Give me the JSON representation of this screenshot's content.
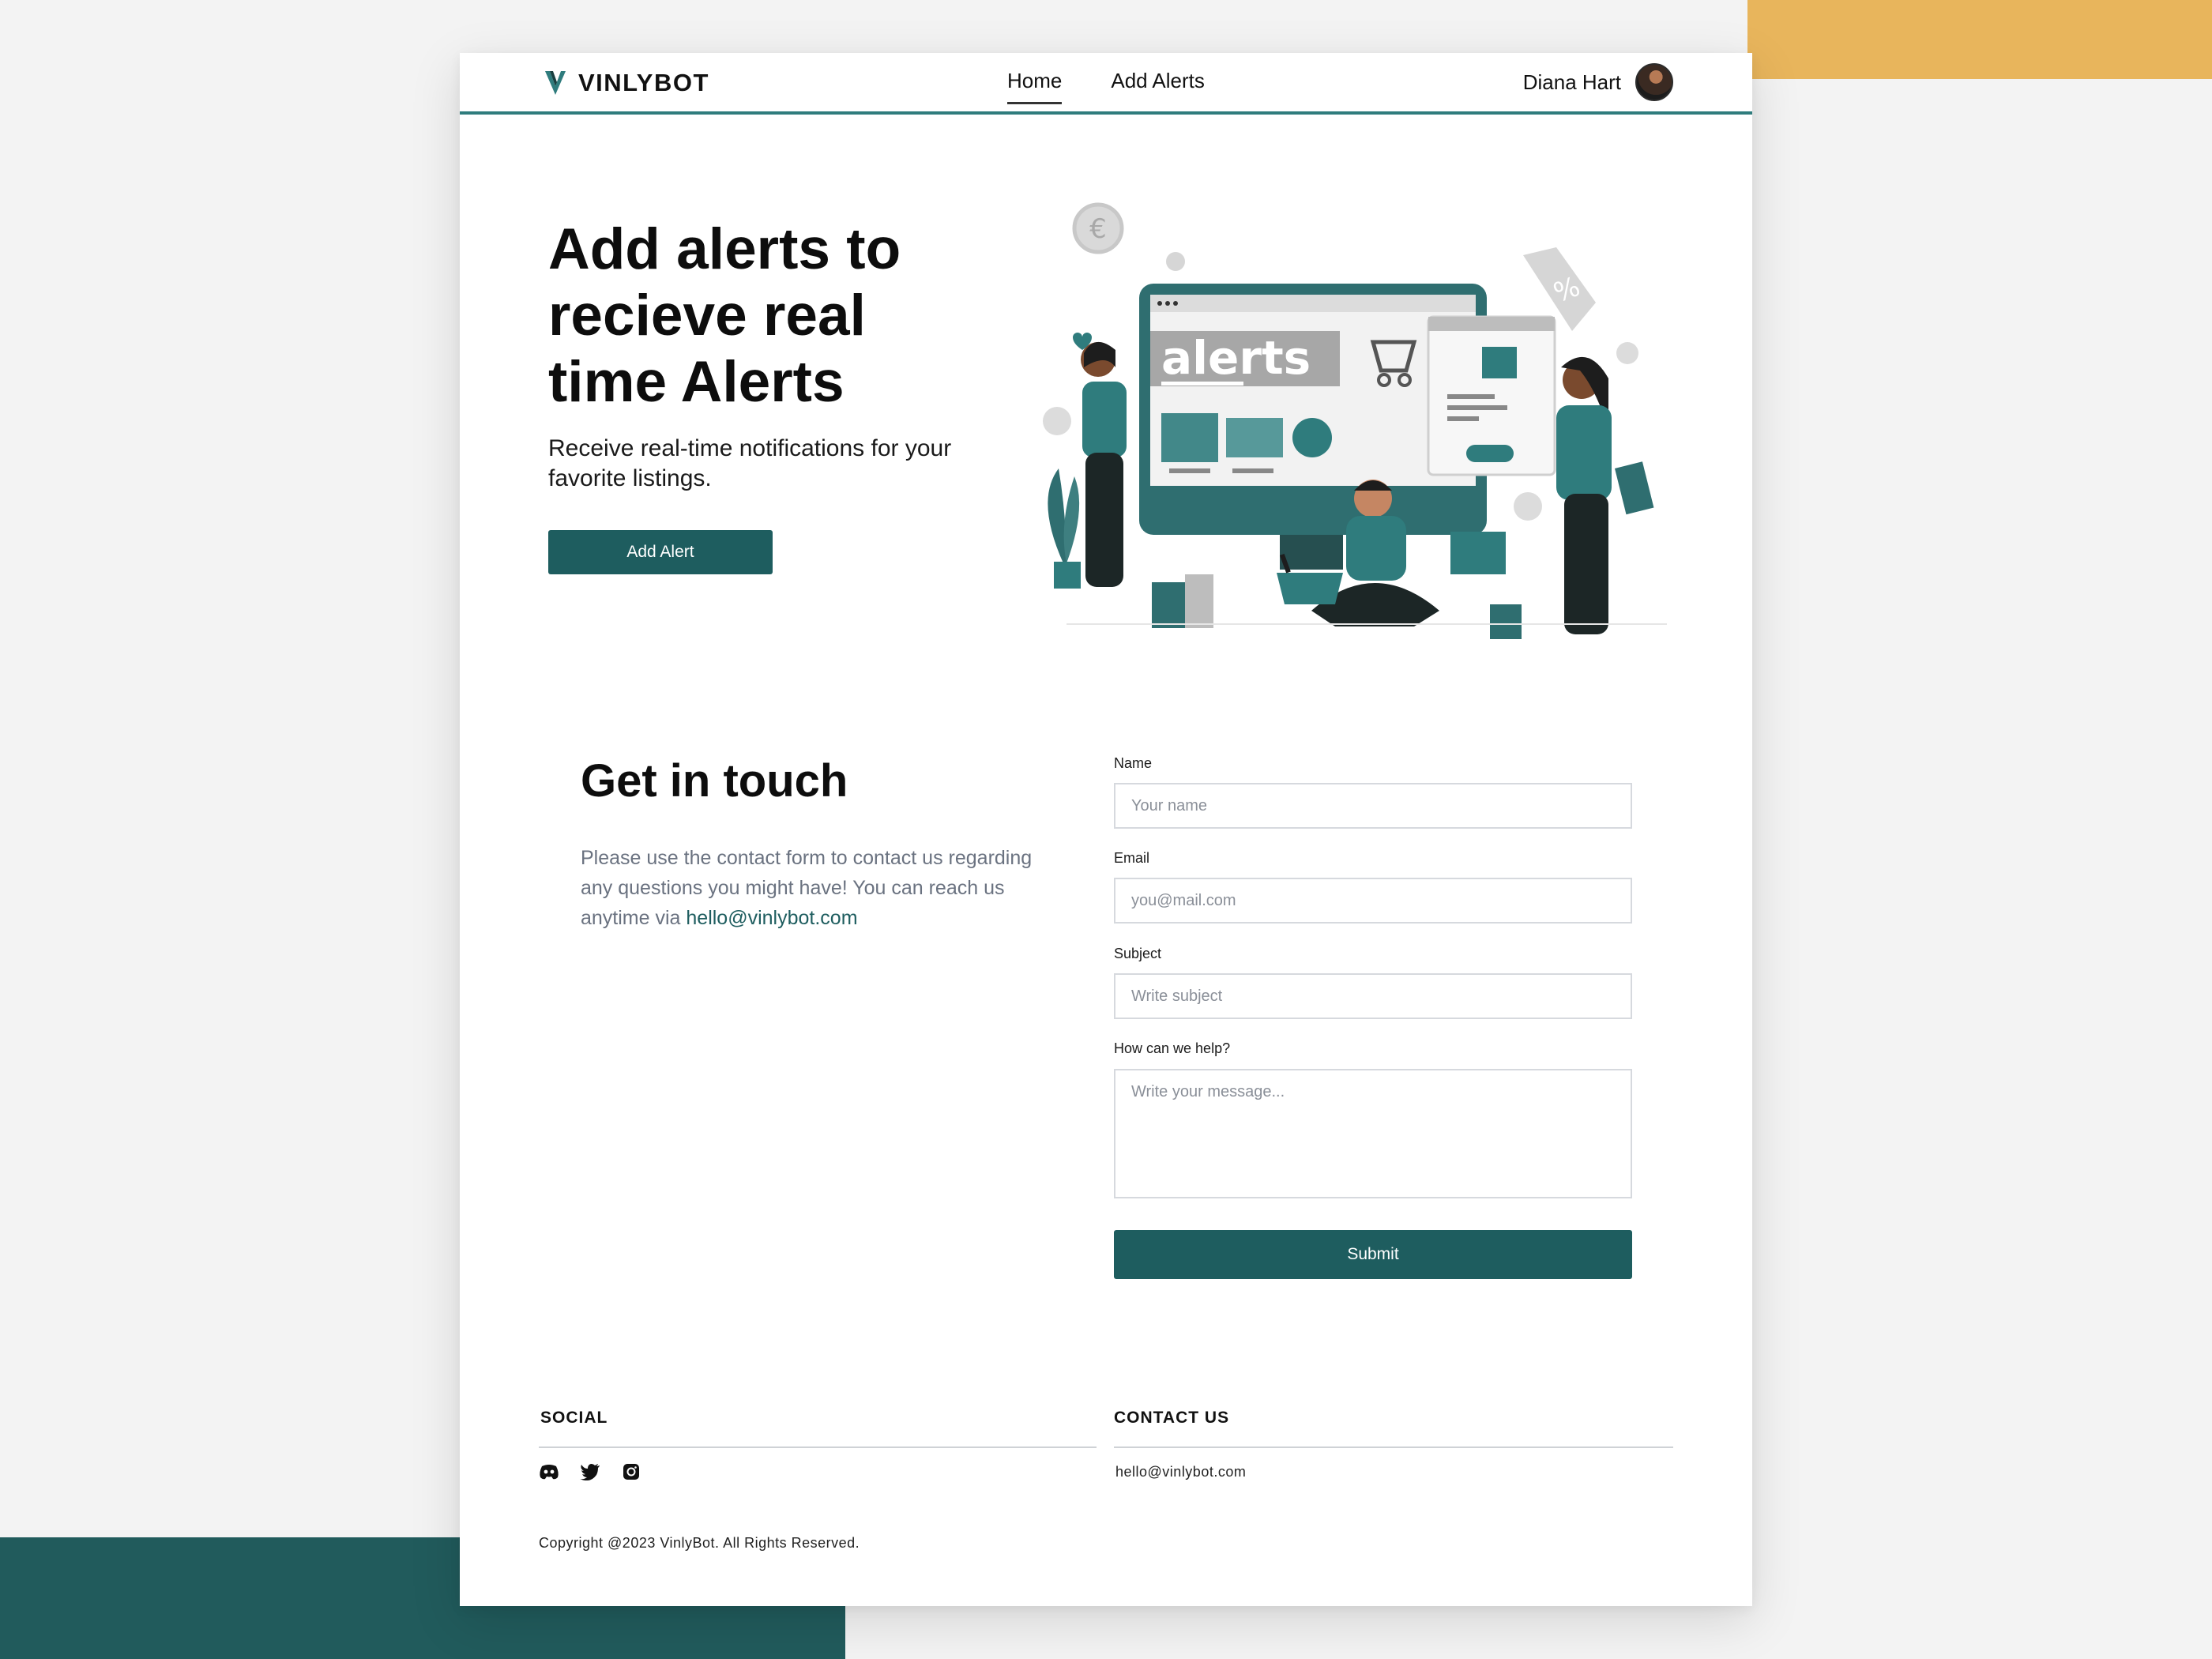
{
  "brand": {
    "name": "VINLYBOT"
  },
  "nav": {
    "links": [
      {
        "label": "Home",
        "active": true
      },
      {
        "label": "Add Alerts",
        "active": false
      }
    ],
    "user_name": "Diana Hart"
  },
  "hero": {
    "title": "Add alerts to recieve real time Alerts",
    "subtitle": "Receive real-time notifications for your favorite listings.",
    "button_label": "Add Alert",
    "illustration_text": "alerts"
  },
  "contact": {
    "title": "Get in touch",
    "text": "Please use the contact form to contact us regarding any questions you might have! You can reach us anytime via ",
    "email": "hello@vinlybot.com"
  },
  "form": {
    "name_label": "Name",
    "name_placeholder": "Your name",
    "email_label": "Email",
    "email_placeholder": "you@mail.com",
    "subject_label": "Subject",
    "subject_placeholder": "Write subject",
    "message_label": "How can we help?",
    "message_placeholder": "Write your message...",
    "submit_label": "Submit"
  },
  "footer": {
    "social_heading": "SOCIAL",
    "social_icons": [
      "discord-icon",
      "twitter-icon",
      "instagram-icon"
    ],
    "contact_heading": "CONTACT US",
    "contact_email": "hello@vinlybot.com",
    "copyright": "Copyright @2023 VinlyBot. All Rights Reserved."
  },
  "colors": {
    "accent": "#1e5d5f",
    "nav_border": "#2f7c7d",
    "bg_gold": "#e8b55c",
    "bg_teal": "#215b5c"
  }
}
